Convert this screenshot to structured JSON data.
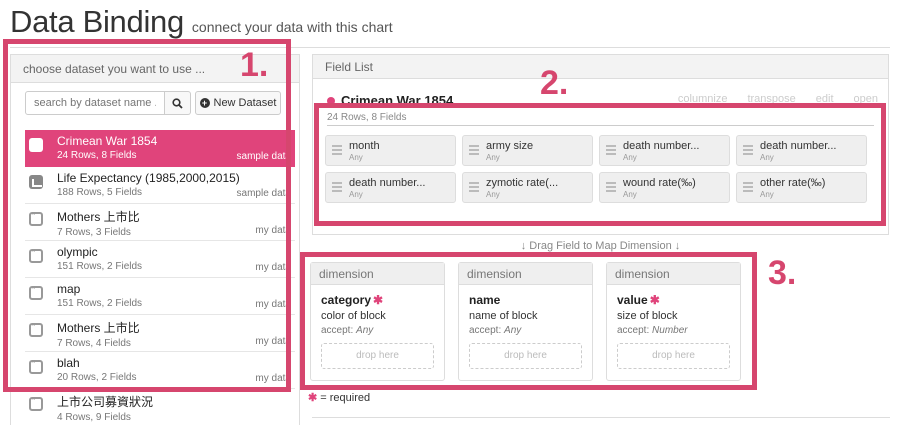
{
  "header": {
    "title": "Data Binding",
    "subtitle": "connect your data with this chart"
  },
  "left": {
    "heading": "choose dataset you want to use ...",
    "search_placeholder": "search by dataset name ...",
    "new_dataset_label": "New Dataset",
    "datasets": [
      {
        "name": "Crimean War 1854",
        "rows": "24 Rows, 8 Fields",
        "tag": "sample data",
        "icon": "chart-icon"
      },
      {
        "name": "Life Expectancy (1985,2000,2015)",
        "rows": "188 Rows, 5 Fields",
        "tag": "sample data",
        "icon": "chart-icon"
      },
      {
        "name": "Mothers 上市比",
        "rows": "7 Rows, 3 Fields",
        "tag": "my data",
        "icon": "quote-icon"
      },
      {
        "name": "olympic",
        "rows": "151 Rows, 2 Fields",
        "tag": "my data",
        "icon": "quote-icon"
      },
      {
        "name": "map",
        "rows": "151 Rows, 2 Fields",
        "tag": "my data",
        "icon": "quote-icon"
      },
      {
        "name": "Mothers 上市比",
        "rows": "7 Rows, 4 Fields",
        "tag": "my data",
        "icon": "quote-icon"
      },
      {
        "name": "blah",
        "rows": "20 Rows, 2 Fields",
        "tag": "my data",
        "icon": "quote-icon"
      },
      {
        "name": "上市公司募資狀況",
        "rows": "4 Rows, 9 Fields",
        "tag": "",
        "icon": "quote-icon"
      }
    ]
  },
  "field_list": {
    "heading": "Field List",
    "dataset_title": "Crimean War 1854",
    "actions": [
      "columnize",
      "transpose",
      "edit",
      "open"
    ],
    "meta": "24 Rows, 8 Fields",
    "fields": [
      {
        "name": "month",
        "type": "Any"
      },
      {
        "name": "army size",
        "type": "Any"
      },
      {
        "name": "death number...",
        "type": "Any"
      },
      {
        "name": "death number...",
        "type": "Any"
      },
      {
        "name": "death number...",
        "type": "Any"
      },
      {
        "name": "zymotic rate(...",
        "type": "Any"
      },
      {
        "name": "wound rate(‰)",
        "type": "Any"
      },
      {
        "name": "other rate(‰)",
        "type": "Any"
      }
    ]
  },
  "drag_hint": "Drag Field to Map Dimension",
  "dimensions": [
    {
      "header": "dimension",
      "name": "category",
      "required": true,
      "desc": "color of block",
      "accept_label": "accept:",
      "accept": "Any",
      "drop": "drop here"
    },
    {
      "header": "dimension",
      "name": "name",
      "required": false,
      "desc": "name of block",
      "accept_label": "accept:",
      "accept": "Any",
      "drop": "drop here"
    },
    {
      "header": "dimension",
      "name": "value",
      "required": true,
      "desc": "size of block",
      "accept_label": "accept:",
      "accept": "Number",
      "drop": "drop here"
    }
  ],
  "required_note": "= required",
  "annotations": [
    "1.",
    "2.",
    "3."
  ],
  "colors": {
    "accent": "#e0447b",
    "annotation": "#d6466e"
  }
}
